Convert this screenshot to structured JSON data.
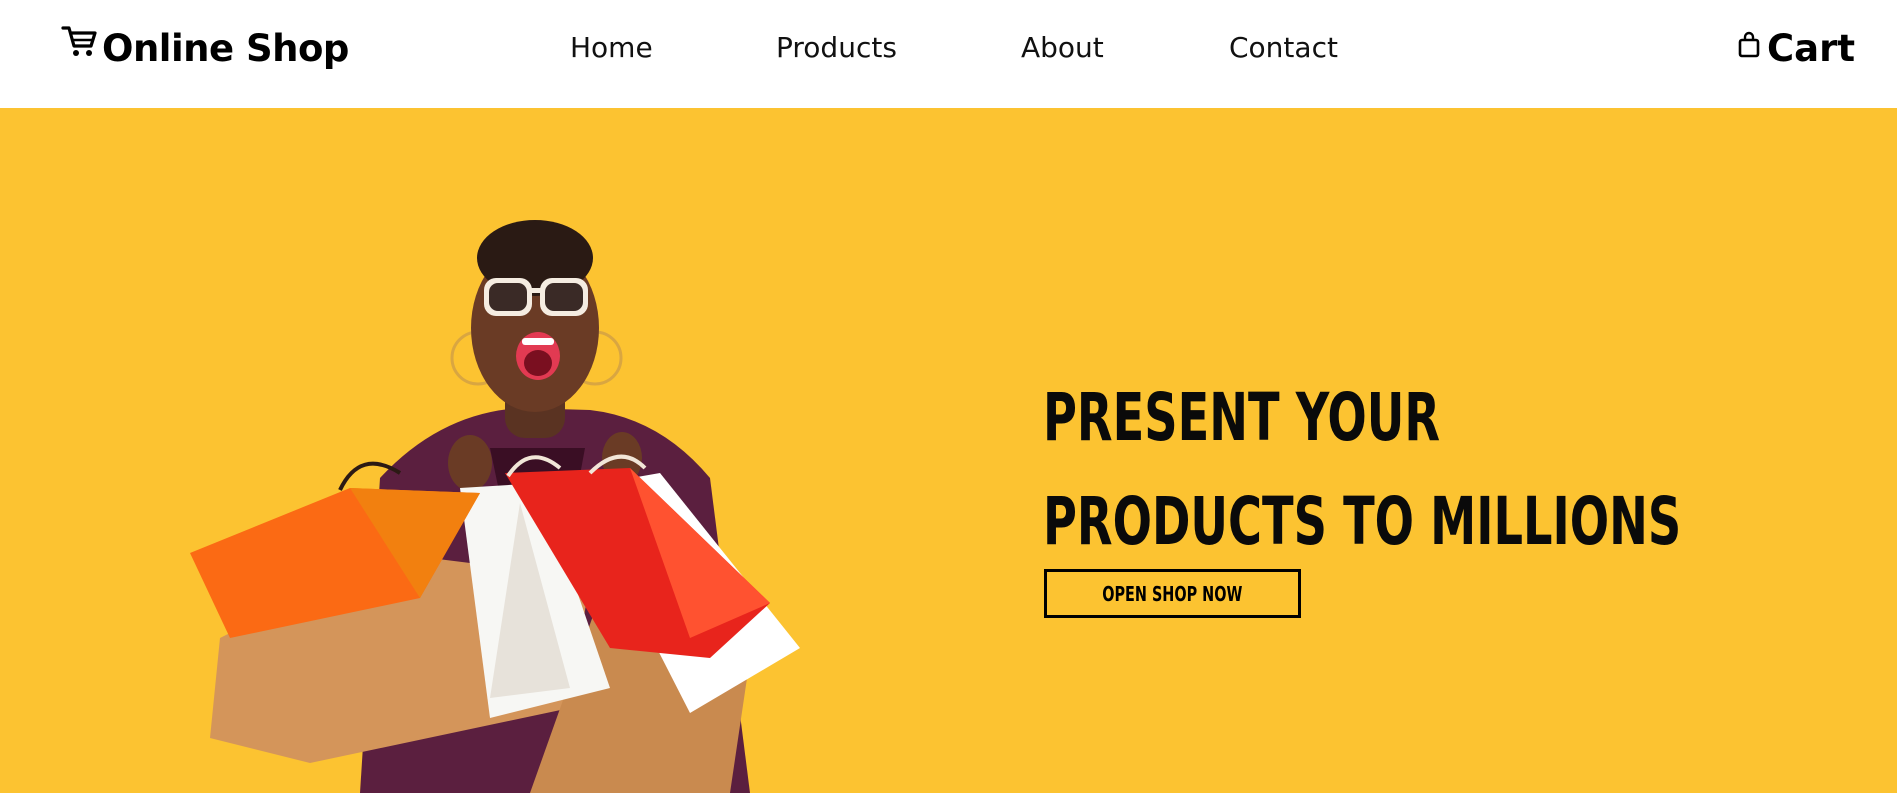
{
  "header": {
    "logo": {
      "icon": "shopping-cart-icon",
      "text": "Online Shop"
    },
    "nav": [
      {
        "label": "Home"
      },
      {
        "label": "Products"
      },
      {
        "label": "About"
      },
      {
        "label": "Contact"
      }
    ],
    "cart": {
      "icon": "shopping-bag-icon",
      "label": "Cart"
    }
  },
  "hero": {
    "background_color": "#fcc331",
    "image": "woman-with-shopping-bags",
    "headline_line1": "PRESENT YOUR",
    "headline_line2": "PRODUCTS TO MILLIONS",
    "cta_label": "OPEN SHOP NOW"
  }
}
